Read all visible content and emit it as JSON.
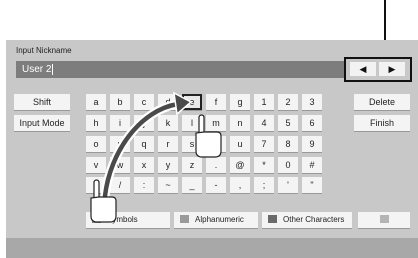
{
  "screen": {
    "title": "Input Nickname",
    "input_value": "User 2"
  },
  "nav": {
    "left_arrow": "◀",
    "right_arrow": "▶"
  },
  "side_keys": [
    "Shift",
    "Input Mode"
  ],
  "right_keys": [
    "Delete",
    "Finish"
  ],
  "char_rows": [
    [
      "a",
      "b",
      "c",
      "d",
      "e",
      "f",
      "g",
      "1",
      "2",
      "3"
    ],
    [
      "h",
      "i",
      "j",
      "k",
      "l",
      "m",
      "n",
      "4",
      "5",
      "6"
    ],
    [
      "o",
      "p",
      "q",
      "r",
      "s",
      "t",
      "u",
      "7",
      "8",
      "9"
    ],
    [
      "v",
      "w",
      "x",
      "y",
      "z",
      ".",
      "@",
      "*",
      "0",
      "#"
    ],
    [
      "!",
      "/",
      ":",
      "~",
      "_",
      "-",
      ",",
      ";",
      "'",
      "\""
    ]
  ],
  "selected_key": "e",
  "mode_buttons": [
    {
      "label": "Symbols",
      "color": "#808080"
    },
    {
      "label": "Alphanumeric",
      "color": "#9a9a9a"
    },
    {
      "label": "Other Characters",
      "color": "#6a6a6a"
    },
    {
      "label": "",
      "color": "#b4b4b4"
    }
  ]
}
